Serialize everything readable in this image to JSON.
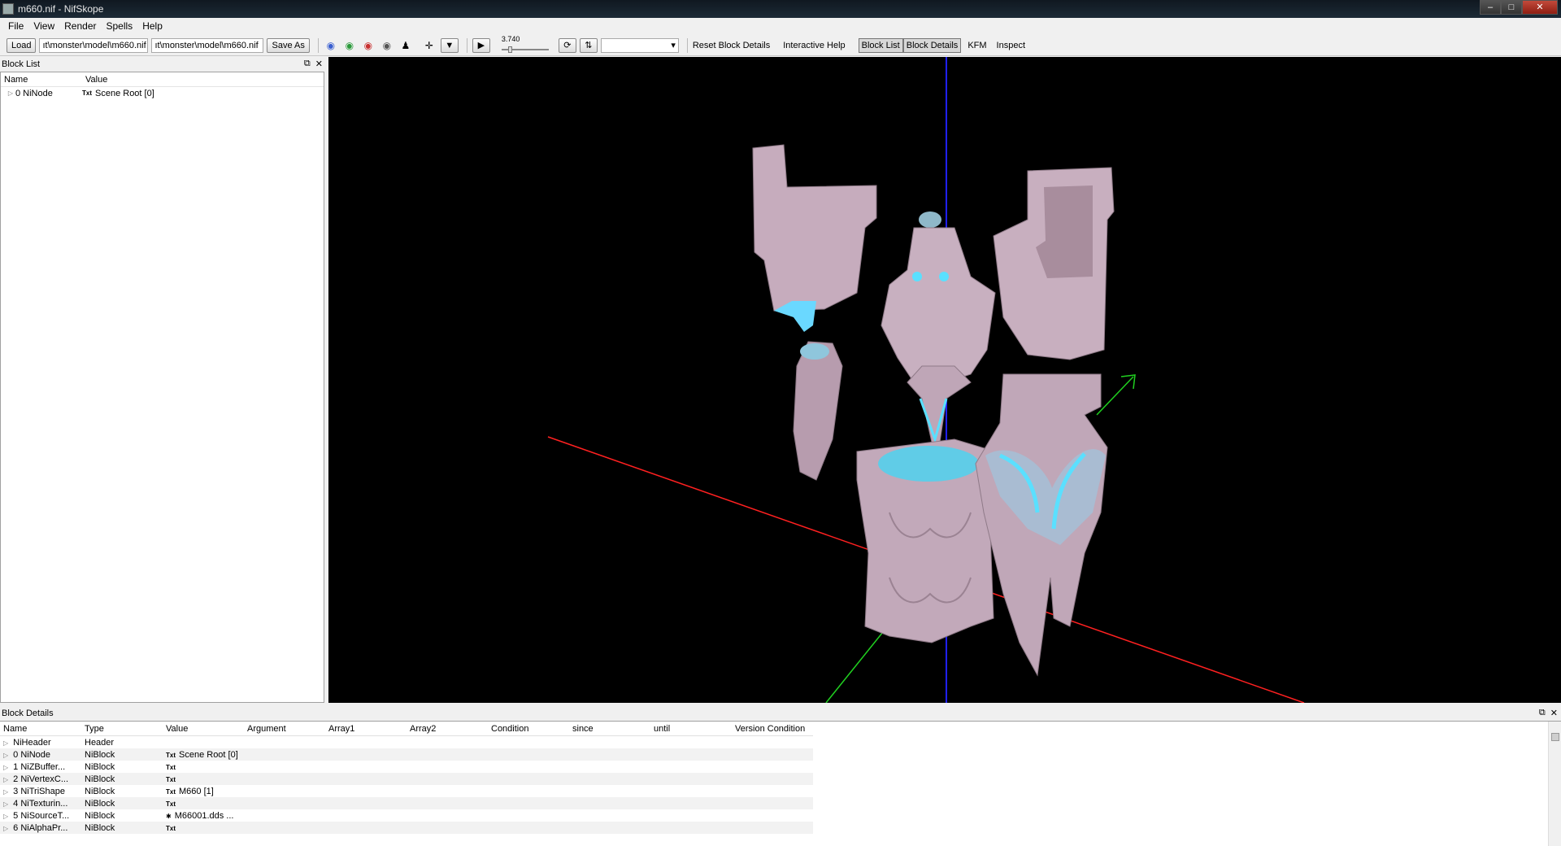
{
  "window": {
    "title": "m660.nif - NifSkope"
  },
  "menu": [
    "File",
    "View",
    "Render",
    "Spells",
    "Help"
  ],
  "toolbar": {
    "load_label": "Load",
    "path_load": "ıt\\monster\\model\\m660.nif",
    "path_save": "ıt\\monster\\model\\m660.nif",
    "save_as_label": "Save As",
    "time_value": "3.740",
    "reset_block_details": "Reset Block Details",
    "interactive_help": "Interactive Help",
    "block_list": "Block List",
    "block_details": "Block Details",
    "kfm": "KFM",
    "inspect": "Inspect"
  },
  "block_list": {
    "title": "Block List",
    "columns": [
      "Name",
      "Value"
    ],
    "rows": [
      {
        "name": "0 NiNode",
        "badge": "Txt",
        "value": "Scene Root [0]"
      }
    ]
  },
  "block_details": {
    "title": "Block Details",
    "columns": [
      "Name",
      "Type",
      "Value",
      "Argument",
      "Array1",
      "Array2",
      "Condition",
      "since",
      "until",
      "Version Condition"
    ],
    "rows": [
      {
        "name": "NiHeader",
        "type": "Header",
        "badge": "",
        "value": ""
      },
      {
        "name": "0 NiNode",
        "type": "NiBlock",
        "badge": "Txt",
        "value": "Scene Root [0]"
      },
      {
        "name": "1 NiZBuffer...",
        "type": "NiBlock",
        "badge": "Txt",
        "value": ""
      },
      {
        "name": "2 NiVertexC...",
        "type": "NiBlock",
        "badge": "Txt",
        "value": ""
      },
      {
        "name": "3 NiTriShape",
        "type": "NiBlock",
        "badge": "Txt",
        "value": "M660 [1]"
      },
      {
        "name": "4 NiTexturin...",
        "type": "NiBlock",
        "badge": "Txt",
        "value": ""
      },
      {
        "name": "5 NiSourceT...",
        "type": "NiBlock",
        "badge": "✱",
        "value": "M66001.dds ..."
      },
      {
        "name": "6 NiAlphaPr...",
        "type": "NiBlock",
        "badge": "Txt",
        "value": ""
      }
    ]
  },
  "colors": {
    "axis_x": "#ff2020",
    "axis_y": "#20d020",
    "axis_z": "#2020ff",
    "model": "#cdb5c4",
    "glow": "#5ae0ff"
  }
}
